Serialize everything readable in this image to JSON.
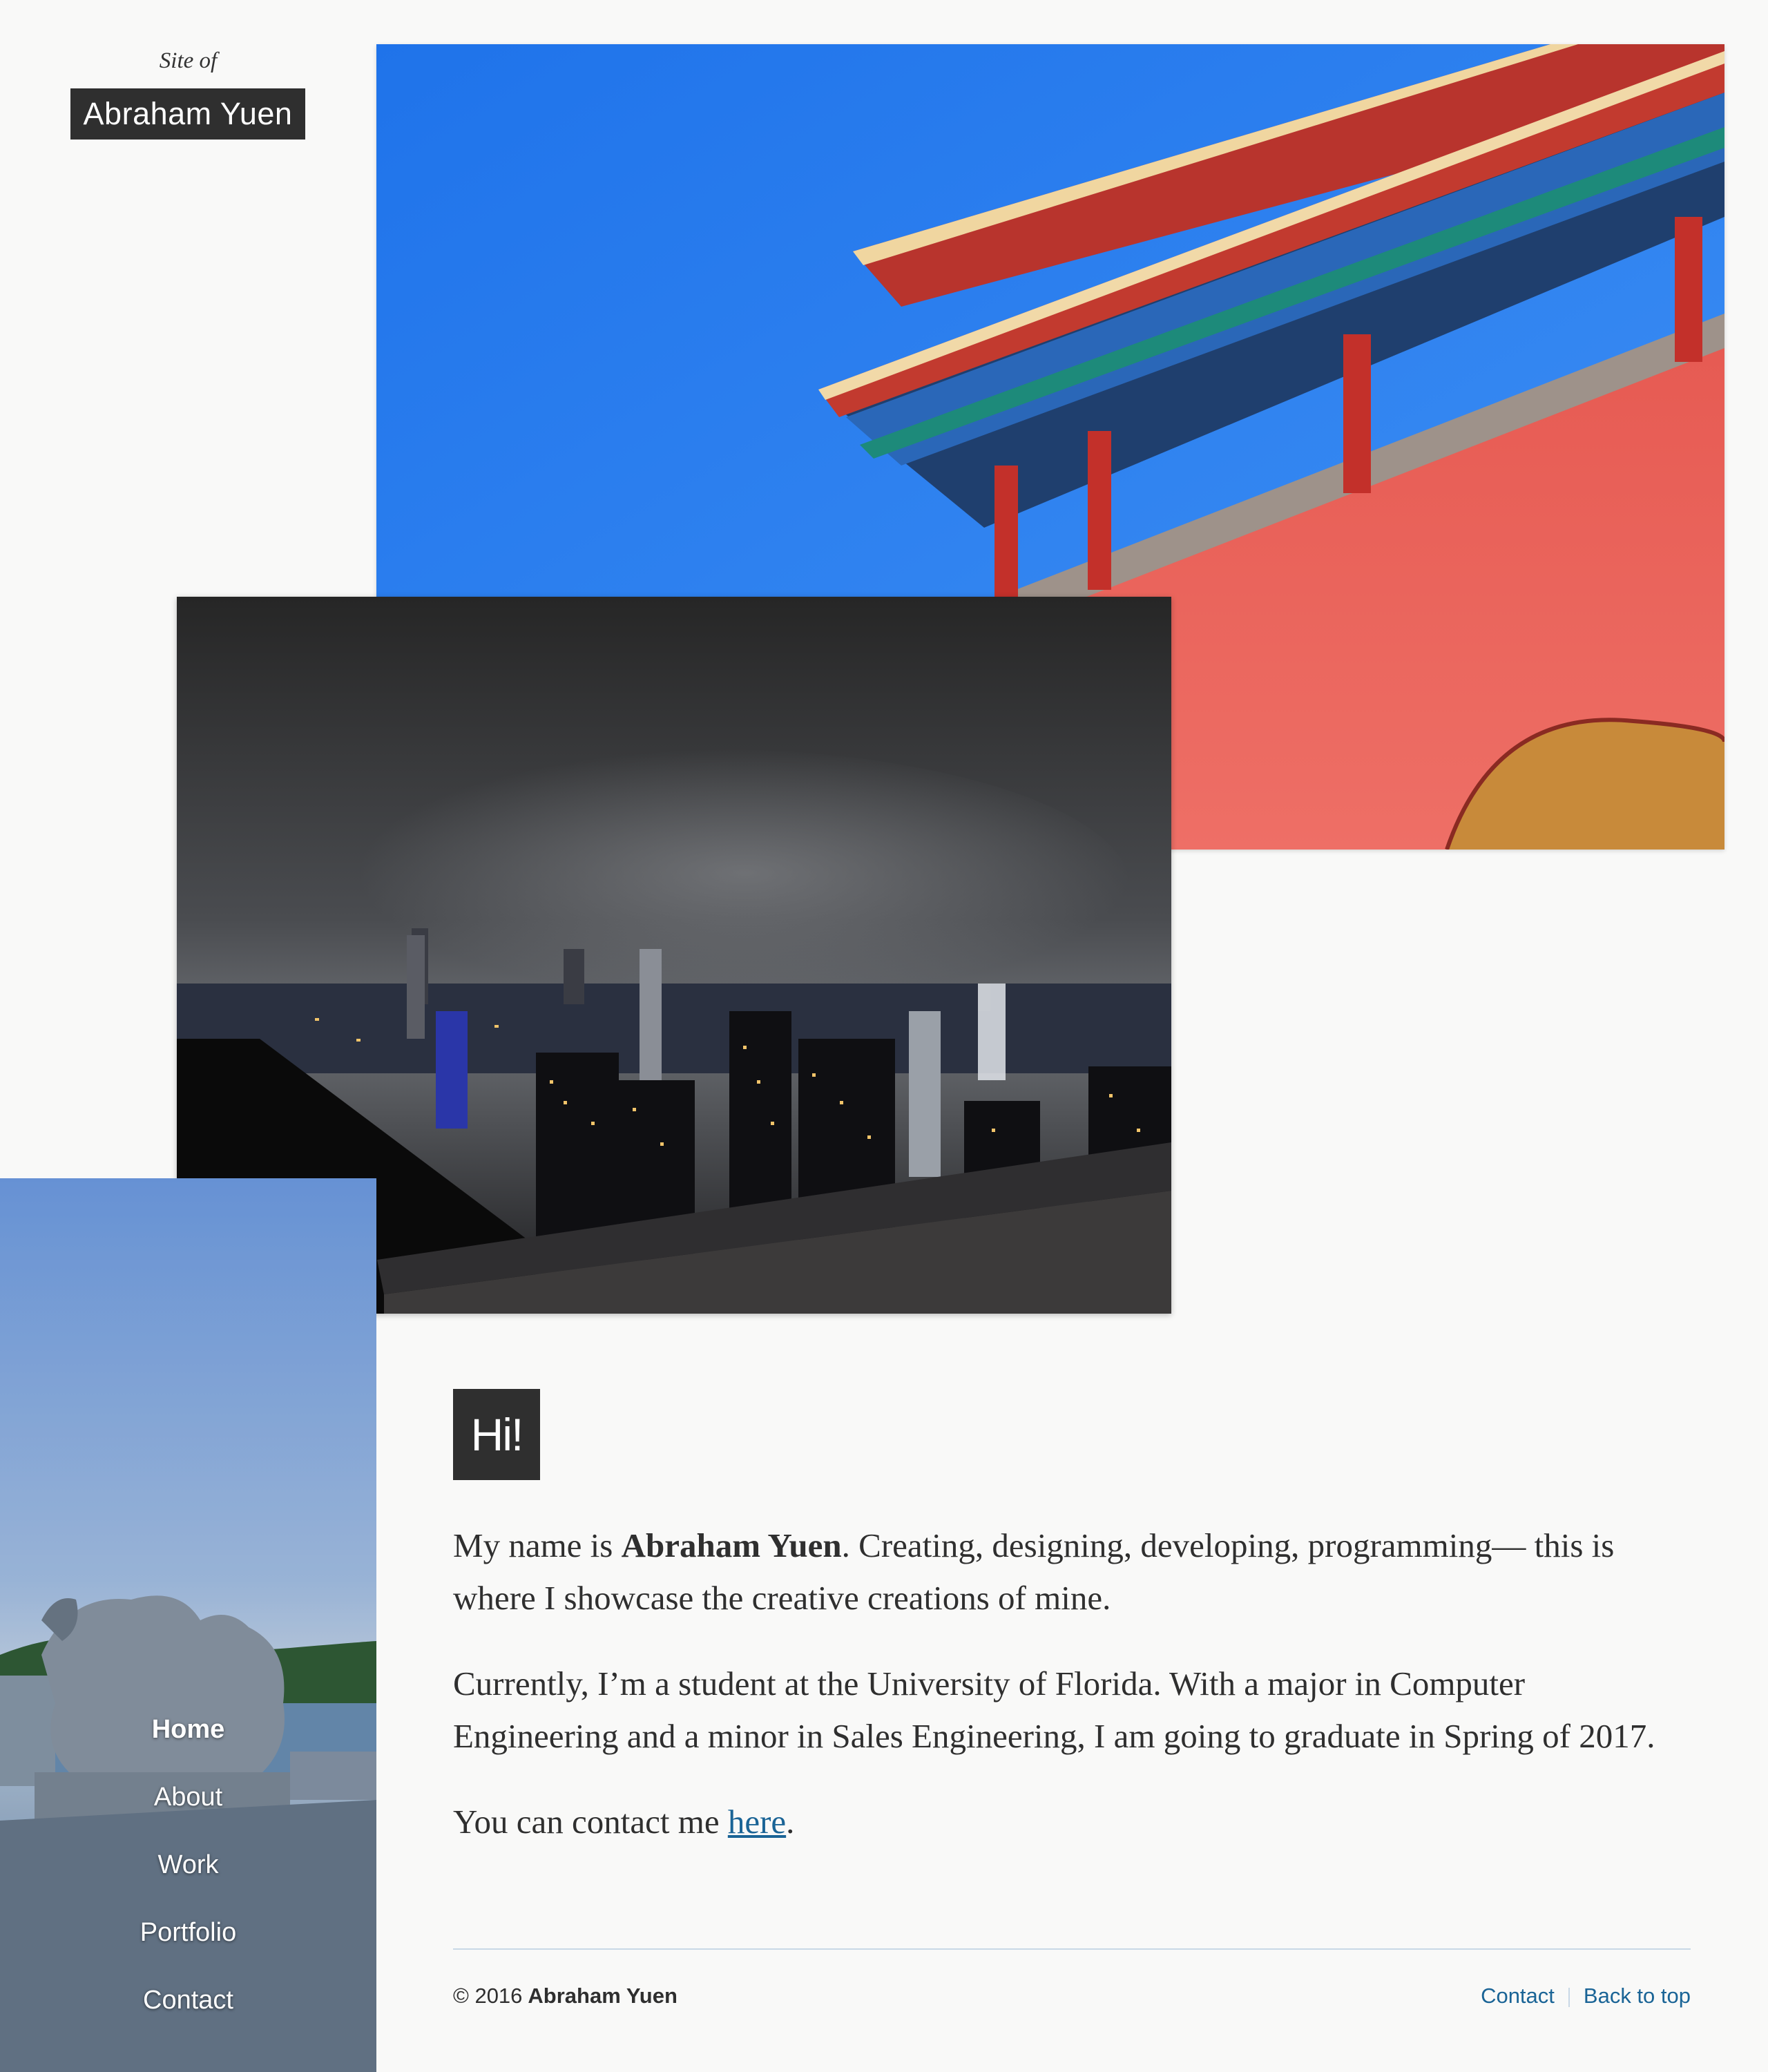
{
  "header": {
    "site_of": "Site of",
    "site_name": "Abraham Yuen"
  },
  "photos": {
    "palace": {
      "icon": "palace-photo"
    },
    "city": {
      "icon": "city-night-photo"
    },
    "sidebar": {
      "icon": "stone-lion-bridge-photo"
    }
  },
  "nav": {
    "items": [
      {
        "label": "Home",
        "active": true
      },
      {
        "label": "About"
      },
      {
        "label": "Work"
      },
      {
        "label": "Portfolio"
      },
      {
        "label": "Contact"
      }
    ]
  },
  "main": {
    "hi": "Hi!",
    "p1": {
      "pre": "My name is ",
      "name": "Abraham Yuen",
      "post": ". Creating, designing, developing, programming— this is where I showcase the creative creations of mine."
    },
    "p2": "Currently, I’m a student at the University of Florida. With a major in Computer Engineering and a minor in Sales Engineering, I am going to graduate in Spring of 2017.",
    "p3": {
      "pre": "You can contact me ",
      "link": "here",
      "post": "."
    }
  },
  "footer": {
    "copyright": "© 2016",
    "name": "Abraham Yuen",
    "links": [
      "Contact",
      "Back to top"
    ]
  },
  "colors": {
    "background": "#f9f9f8",
    "dark": "#2f2f2f",
    "link": "#1a6496",
    "rule": "#c8d8e6"
  }
}
